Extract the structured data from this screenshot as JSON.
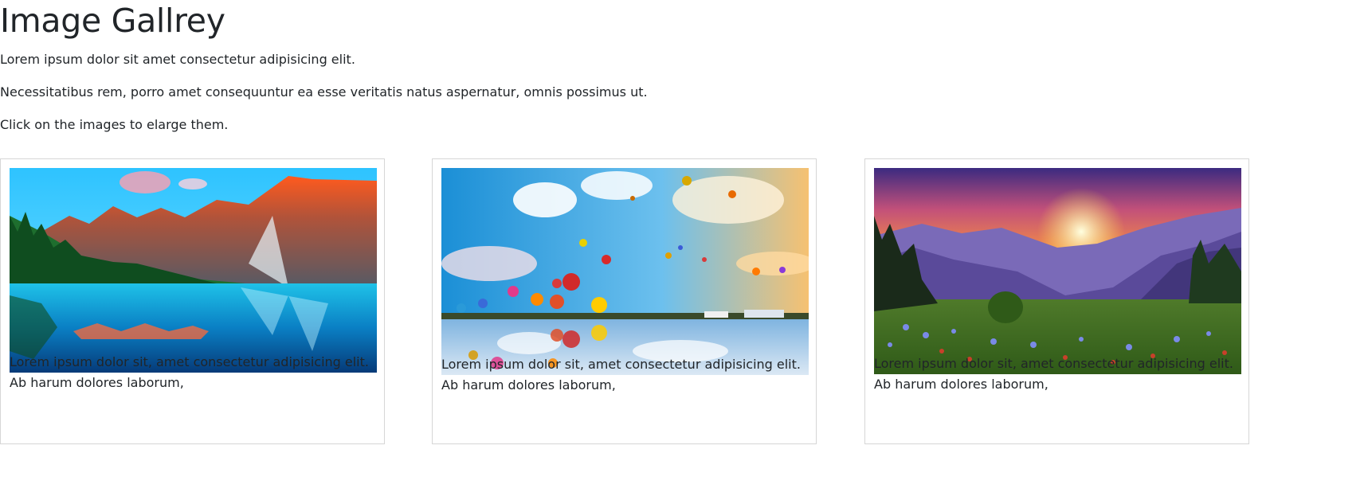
{
  "page": {
    "title": "Image Gallrey",
    "paragraphs": [
      "Lorem ipsum dolor sit amet consectetur adipisicing elit.",
      "Necessitatibus rem, porro amet consequuntur ea esse veritatis natus aspernatur, omnis possimus ut.",
      "Click on the images to elarge them."
    ]
  },
  "gallery": {
    "cards": [
      {
        "image": "mountain-lake-image",
        "caption_line1": "Lorem ipsum dolor sit, amet consectetur adipisicing elit.",
        "caption_line2": "Ab harum dolores laborum,"
      },
      {
        "image": "hot-air-balloons-image",
        "caption_line1": "Lorem ipsum dolor sit, amet consectetur adipisicing elit.",
        "caption_line2": "Ab harum dolores laborum,"
      },
      {
        "image": "mountain-sunset-image",
        "caption_line1": "Lorem ipsum dolor sit, amet consectetur adipisicing elit.",
        "caption_line2": "Ab harum dolores laborum,"
      }
    ]
  },
  "colors": {
    "text": "#212529",
    "card_border": "#d6d6d6"
  }
}
